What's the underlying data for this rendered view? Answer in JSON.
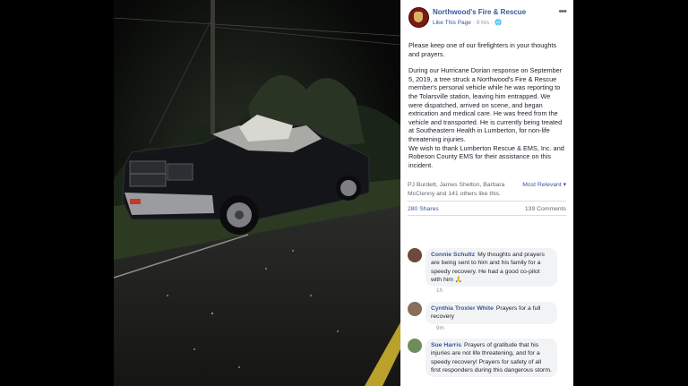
{
  "page": {
    "name": "Northwood's Fire & Rescue",
    "like_link": "Like This Page",
    "separator": "·",
    "time": "9 hrs",
    "more": "•••"
  },
  "post": {
    "paragraph1": "Please keep one of our firefighters in your thoughts and prayers.",
    "paragraph2": "During our Hurricane Dorian response on September 5, 2019, a tree struck a Northwood's Fire & Rescue member's personal vehicle while he was reporting to the Tolarsville station, leaving him entrapped. We were dispatched, arrived on scene, and began extrication and medical care. He was freed from the vehicle and transported. He is currently being treated at Southeastern Health in Lumberton, for non-life threatening injuries.",
    "paragraph3": "We wish to thank Lumberton Rescue & EMS, Inc. and Robeson County EMS for their assistance on this incident."
  },
  "reactions": {
    "text": "PJ Burdett, James Shelton, Barbara McClenny and 141 others like this.",
    "sort": "Most Relevant ▾"
  },
  "stats": {
    "shares": "280 Shares",
    "comments": "139 Comments"
  },
  "comments": [
    {
      "author": "Connie Schultz",
      "text": "My thoughts and prayers are being sent to him and his family for a speedy recovery. He had a good co-pilot with him 🙏",
      "time": "1h"
    },
    {
      "author": "Cynthia Troxler White",
      "text": "Prayers for a full recovery",
      "time": "9m"
    },
    {
      "author": "Sue Harris",
      "text": "Prayers of gratitude that his injuries are not life threatening, and for a speedy recovery! Prayers for safety of all first responders during this dangerous storm.",
      "time": ""
    }
  ],
  "colors": {
    "link": "#385898",
    "text": "#1d2129",
    "muted": "#90949c",
    "bubble": "#f2f3f5"
  }
}
